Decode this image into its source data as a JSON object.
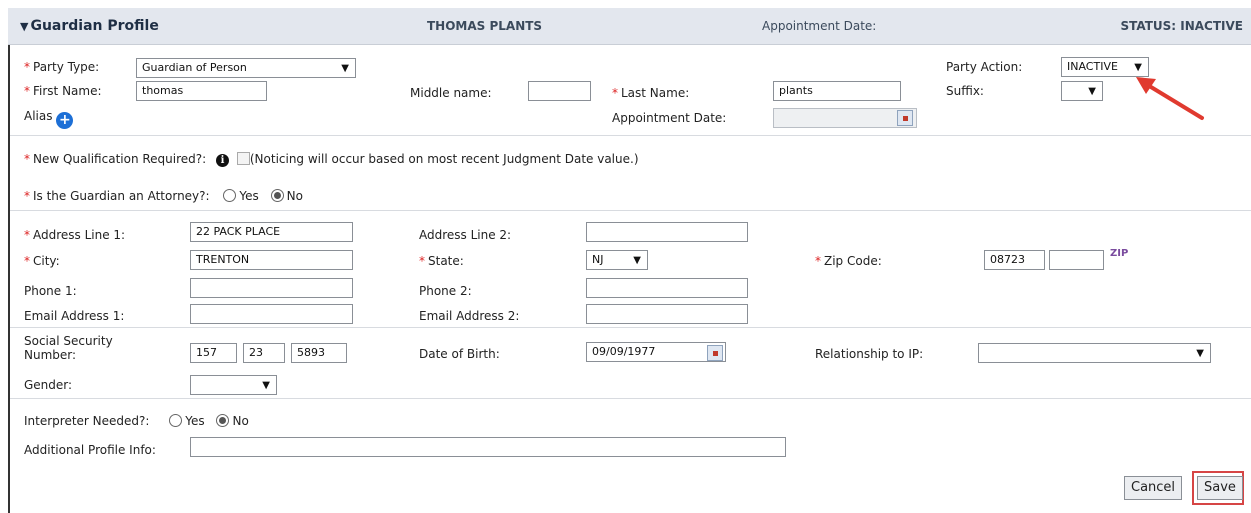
{
  "header": {
    "title": "Guardian Profile",
    "party_name": "THOMAS PLANTS",
    "appointment_label": "Appointment Date:",
    "status": "STATUS: INACTIVE"
  },
  "party": {
    "party_type_label": "Party Type:",
    "party_type_value": "Guardian of Person",
    "party_action_label": "Party Action:",
    "party_action_value": "INACTIVE",
    "first_name_label": "First Name:",
    "first_name_value": "thomas",
    "middle_name_label": "Middle name:",
    "middle_name_value": "",
    "last_name_label": "Last Name:",
    "last_name_value": "plants",
    "suffix_label": "Suffix:",
    "suffix_value": "",
    "alias_label": "Alias",
    "appointment_date_label": "Appointment Date:",
    "appointment_date_value": ""
  },
  "qualification": {
    "label": "New Qualification Required?:",
    "note": "(Noticing will occur based on most recent Judgment Date value.)"
  },
  "attorney": {
    "label": "Is the Guardian an Attorney?:",
    "yes": "Yes",
    "no": "No",
    "selected": "No"
  },
  "address": {
    "line1_label": "Address Line 1:",
    "line1_value": "22 PACK PLACE",
    "line2_label": "Address Line 2:",
    "line2_value": "",
    "city_label": "City:",
    "city_value": "TRENTON",
    "state_label": "State:",
    "state_value": "NJ",
    "zip_label": "Zip Code:",
    "zip_value": "08723",
    "zip_ext_value": "",
    "zip_icon_text": "ZIP",
    "phone1_label": "Phone 1:",
    "phone1_value": "",
    "phone2_label": "Phone 2:",
    "phone2_value": "",
    "email1_label": "Email Address 1:",
    "email1_value": "",
    "email2_label": "Email Address 2:",
    "email2_value": ""
  },
  "personal": {
    "ssn_label": "Social Security Number:",
    "ssn_part1": "157",
    "ssn_part2": "23",
    "ssn_part3": "5893",
    "dob_label": "Date of Birth:",
    "dob_value": "09/09/1977",
    "relationship_label": "Relationship to IP:",
    "relationship_value": "",
    "gender_label": "Gender:",
    "gender_value": ""
  },
  "interpreter": {
    "label": "Interpreter Needed?:",
    "yes": "Yes",
    "no": "No",
    "selected": "No",
    "additional_label": "Additional Profile Info:",
    "additional_value": ""
  },
  "actions": {
    "cancel": "Cancel",
    "save": "Save"
  },
  "colors": {
    "header_bg": "#e3e7ee",
    "required_star": "#dd2222",
    "highlight_red": "#d64545",
    "alias_plus": "#1d6fd6"
  },
  "icons": {
    "alias_add": "plus-circle-icon",
    "qualification_info": "info-icon",
    "calendar": "calendar-icon",
    "zip_lookup": "zip-lookup-icon",
    "dropdown": "chevron-down-icon",
    "pointer_arrow": "red-arrow-annotation"
  }
}
